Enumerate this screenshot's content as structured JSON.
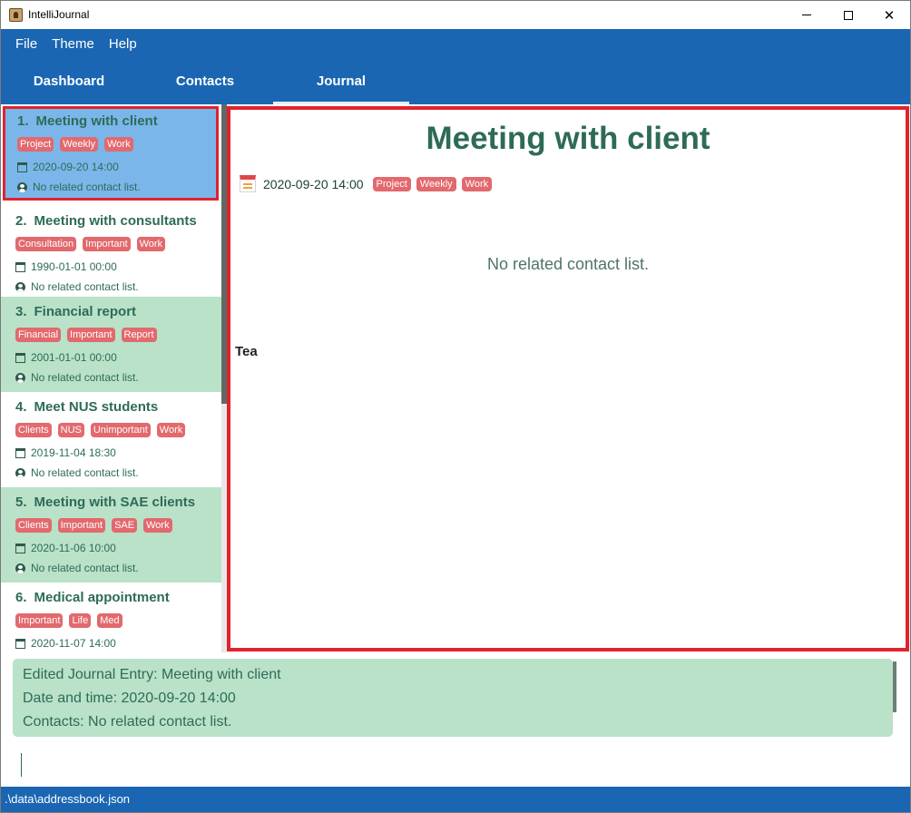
{
  "window": {
    "title": "IntelliJournal"
  },
  "menu": [
    "File",
    "Theme",
    "Help"
  ],
  "tabs": [
    "Dashboard",
    "Contacts",
    "Journal"
  ],
  "active_tab": "Journal",
  "entries": [
    {
      "index": "1.",
      "title": "Meeting with client",
      "tags": [
        "Project",
        "Weekly",
        "Work"
      ],
      "datetime": "2020-09-20 14:00",
      "contacts": "No related contact list.",
      "style": "selected"
    },
    {
      "index": "2.",
      "title": "Meeting with consultants",
      "tags": [
        "Consultation",
        "Important",
        "Work"
      ],
      "datetime": "1990-01-01 00:00",
      "contacts": "No related contact list.",
      "style": "white"
    },
    {
      "index": "3.",
      "title": "Financial report",
      "tags": [
        "Financial",
        "Important",
        "Report"
      ],
      "datetime": "2001-01-01 00:00",
      "contacts": "No related contact list.",
      "style": "green"
    },
    {
      "index": "4.",
      "title": "Meet NUS students",
      "tags": [
        "Clients",
        "NUS",
        "Unimportant",
        "Work"
      ],
      "datetime": "2019-11-04 18:30",
      "contacts": "No related contact list.",
      "style": "white"
    },
    {
      "index": "5.",
      "title": "Meeting with SAE clients",
      "tags": [
        "Clients",
        "Important",
        "SAE",
        "Work"
      ],
      "datetime": "2020-11-06 10:00",
      "contacts": "No related contact list.",
      "style": "green"
    },
    {
      "index": "6.",
      "title": "Medical appointment",
      "tags": [
        "Important",
        "Life",
        "Med"
      ],
      "datetime": "2020-11-07 14:00",
      "contacts": "",
      "style": "white"
    }
  ],
  "detail": {
    "title": "Meeting with client",
    "datetime": "2020-09-20 14:00",
    "tags": [
      "Project",
      "Weekly",
      "Work"
    ],
    "contacts": "No related contact list.",
    "description": "Tea"
  },
  "result": {
    "lines": [
      "Edited Journal Entry: Meeting with client",
      "Date and time: 2020-09-20 14:00",
      "Contacts: No related contact list."
    ]
  },
  "command": {
    "value": ""
  },
  "status": {
    "path": ".\\data\\addressbook.json"
  },
  "colors": {
    "brand": "#1b66b3",
    "tag": "#e2696d",
    "selected": "#7bb6ea",
    "alt_row": "#b9e2c9",
    "highlight_border": "#e0232f",
    "text_primary": "#2e6b57"
  }
}
